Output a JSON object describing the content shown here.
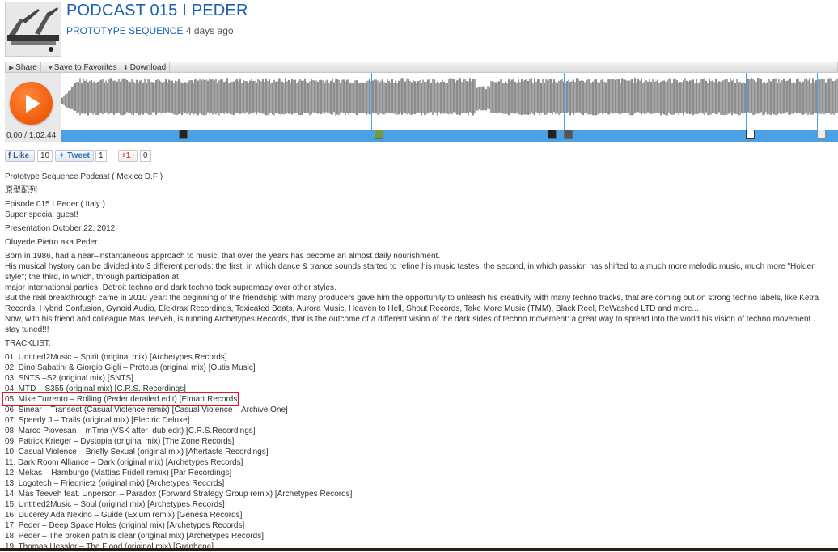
{
  "header": {
    "title": "PODCAST 015 I PEDER",
    "author": "PROTOTYPE SEQUENCE",
    "posted": "4 days ago"
  },
  "toolbar": {
    "share": "Share",
    "favorites": "Save to Favorites",
    "download": "Download"
  },
  "player": {
    "time": "0.00 / 1.02.44",
    "accent": "#f26c1c",
    "progress_color": "#4aa1e6"
  },
  "social": {
    "like_label": "Like",
    "like_count": "10",
    "tweet_label": "Tweet",
    "tweet_count": "1",
    "plus_label": "+1",
    "plus_count": "0"
  },
  "description": [
    "Prototype Sequence Podcast ( Mexico D.F )",
    "原型配列",
    "Episode 015 I Peder ( Italy )",
    "Super special guest!",
    "Presentation October 22, 2012",
    "Oluyede Pietro aka Peder.",
    "Born in 1986, had a near–instantaneous approach to music, that over the years has become an almost daily nourishment.",
    "His musical hystory can be divided into 3 different periods: the first, in which dance & trance sounds started to refine his music tastes; the second, in which passion has shifted to a much more melodic music, much more \"Holden style\"; the third, in which, through participation at",
    "major international parties, Detroit techno and dark techno took supremacy over other styles.",
    "But the real breakthrough came in 2010 year: the beginning of the friendship with many producers gave him the opportunity to unleash his creativity with many techno tracks, that are coming out on strong techno labels, like Ketra Records, Hybrid Confusion, Gynoid Audio, Elektrax Recordings, Toxicated Beats, Aurora Music, Heaven to Hell, Shout Records, Take More Music (TMM), Black Reel, ReWashed LTD and more...",
    "Now, with his friend and colleague Mas Teeveh, is running Archetypes Records, that is the outcome of a different vision of the dark sides of techno movement: a great way to spread into the world his vision of techno movement... stay tuned!!!",
    "TRACKLIST:"
  ],
  "tracklist": [
    "01. Untitled2Music – Spirit (original mix) [Archetypes Records]",
    "02. Dino Sabatini & Giorgio Gigli – Proteus (original mix) [Outis Music]",
    "03. SNTS –S2 (original mix) [SNTS]",
    "04. MTD – S355 (original mix) [C.R.S. Recordings]",
    "05. Mike Turrento – Rolling (Peder derailed edit) [Elmart Records]",
    "06. Sinear – Transect (Casual Violence remix) [Casual Violence – Archive One]",
    "07. Speedy J – Trails (original mix) [Electric Deluxe]",
    "08. Marco Piovesan – mTma (VSK after–dub edit) [C.R.S.Recordings]",
    "09. Patrick Krieger – Dystopia (original mix) [The Zone Records]",
    "10. Casual Violence – Briefly Sexual (original mix) [Aftertaste Recordings]",
    "11. Dark Room Alliance – Dark (original mix) [Archetypes Records]",
    "12. Mekas – Hamburgo (Mattias Fridell remix) [Par Recordings]",
    "13. Logotech – Friednietz (original mix) [Archetypes Records]",
    "14. Mas Teeveh feat. Unperson – Paradox (Forward Strategy Group remix) [Archetypes Records]",
    "15. Untitled2Music – Soul (original mix) [Archetypes Records]",
    "16. Ducerey Ada Nexino – Guide (Exium remix) [Genesa Records]",
    "17. Peder – Deep Space Holes (original mix) [Archetypes Records]",
    "18. Peder – The broken path is clear (original mix) [Archetypes Records]",
    "19. Thomas Hessler – The Flood (original mix) [Graphene]"
  ]
}
